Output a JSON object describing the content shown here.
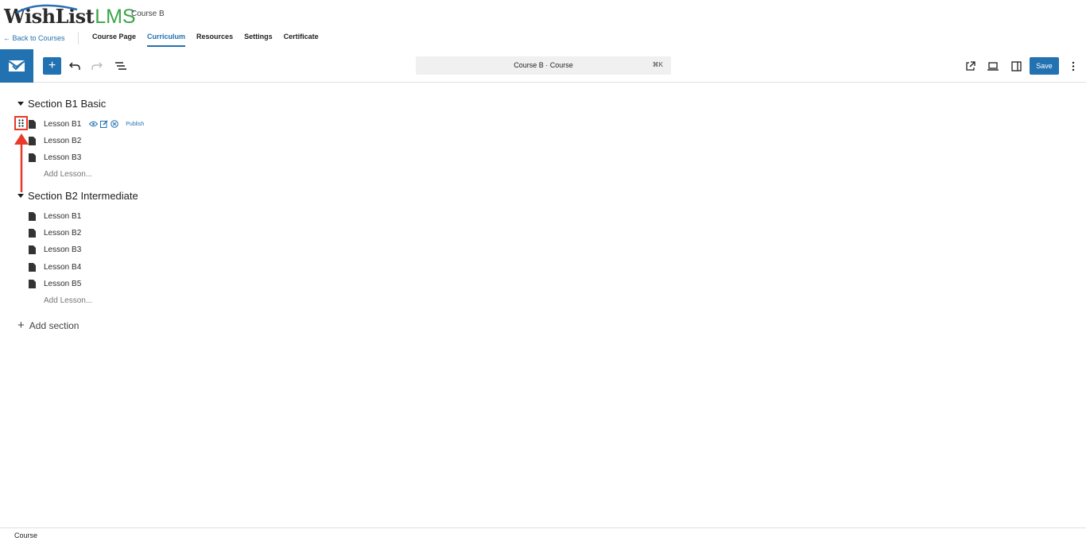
{
  "header": {
    "logo_wish": "WishList",
    "logo_lms": "LMS",
    "course_name": "Course B",
    "back_link": "← Back to Courses",
    "tabs": [
      {
        "label": "Course Page"
      },
      {
        "label": "Curriculum",
        "active": true
      },
      {
        "label": "Resources"
      },
      {
        "label": "Settings"
      },
      {
        "label": "Certificate"
      }
    ]
  },
  "toolbar": {
    "command_title": "Course B · Course",
    "command_shortcut": "⌘K",
    "save_label": "Save"
  },
  "curriculum": {
    "sections": [
      {
        "title": "Section B1 Basic",
        "lessons": [
          "Lesson B1",
          "Lesson B2",
          "Lesson B3"
        ],
        "add_lesson": "Add Lesson..."
      },
      {
        "title": "Section B2 Intermediate",
        "lessons": [
          "Lesson B1",
          "Lesson B2",
          "Lesson B3",
          "Lesson B4",
          "Lesson B5"
        ],
        "add_lesson": "Add Lesson..."
      }
    ],
    "publish_label": "Publish",
    "add_section": "Add section"
  },
  "footer": {
    "breadcrumb": "Course"
  },
  "colors": {
    "accent": "#2271b1",
    "logo_green": "#3aa54a",
    "highlight": "#e8392a"
  }
}
